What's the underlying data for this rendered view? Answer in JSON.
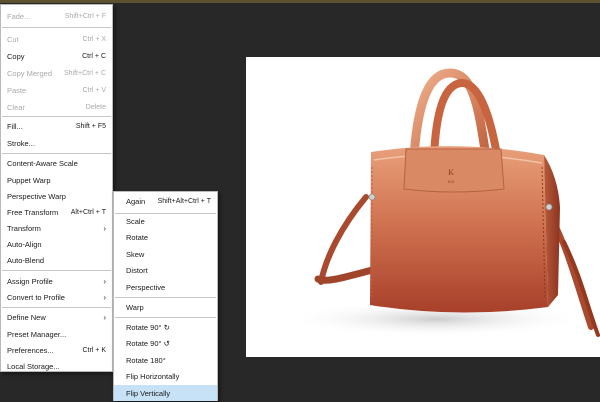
{
  "edit_menu": {
    "items": [
      {
        "label": "Fade...",
        "shortcut": "Shift+Ctrl + F",
        "disabled": true
      },
      {
        "label": "Cut",
        "shortcut": "Ctrl + X",
        "disabled": true
      },
      {
        "label": "Copy",
        "shortcut": "Ctrl + C",
        "disabled": false
      },
      {
        "label": "Copy Merged",
        "shortcut": "Shift+Ctrl + C",
        "disabled": true
      },
      {
        "label": "Paste",
        "shortcut": "Ctrl + V",
        "disabled": true
      },
      {
        "label": "Clear",
        "shortcut": "Delete",
        "disabled": true
      },
      {
        "label": "Fill...",
        "shortcut": "Shift + F5",
        "disabled": false
      },
      {
        "label": "Stroke...",
        "shortcut": "",
        "disabled": false
      },
      {
        "label": "Content-Aware Scale",
        "shortcut": "",
        "disabled": false
      },
      {
        "label": "Puppet Warp",
        "shortcut": "",
        "disabled": false
      },
      {
        "label": "Perspective Warp",
        "shortcut": "",
        "disabled": false
      },
      {
        "label": "Free Transform",
        "shortcut": "Alt+Ctrl + T",
        "disabled": false
      },
      {
        "label": "Transform",
        "shortcut": "",
        "disabled": false,
        "submenu": true
      },
      {
        "label": "Auto-Align",
        "shortcut": "",
        "disabled": false
      },
      {
        "label": "Auto-Blend",
        "shortcut": "",
        "disabled": false
      },
      {
        "label": "Assign Profile",
        "shortcut": "",
        "disabled": false,
        "submenu": true
      },
      {
        "label": "Convert to Profile",
        "shortcut": "",
        "disabled": false,
        "submenu": true
      },
      {
        "label": "Define New",
        "shortcut": "",
        "disabled": false,
        "submenu": true
      },
      {
        "label": "Preset Manager...",
        "shortcut": "",
        "disabled": false
      },
      {
        "label": "Preferences...",
        "shortcut": "Ctrl + K",
        "disabled": false
      },
      {
        "label": "Local Storage...",
        "shortcut": "",
        "disabled": false
      }
    ],
    "arrow_glyph": "›"
  },
  "transform_submenu": {
    "items": [
      {
        "label": "Again",
        "shortcut": "Shift+Alt+Ctrl + T"
      },
      {
        "label": "Scale",
        "shortcut": ""
      },
      {
        "label": "Rotate",
        "shortcut": ""
      },
      {
        "label": "Skew",
        "shortcut": ""
      },
      {
        "label": "Distort",
        "shortcut": ""
      },
      {
        "label": "Perspective",
        "shortcut": ""
      },
      {
        "label": "Warp",
        "shortcut": ""
      },
      {
        "label": "Rotate 90° ↻",
        "shortcut": ""
      },
      {
        "label": "Rotate 90° ↺",
        "shortcut": ""
      },
      {
        "label": "Rotate 180°",
        "shortcut": ""
      },
      {
        "label": "Flip Horizontally",
        "shortcut": ""
      },
      {
        "label": "Flip Vertically",
        "shortcut": "",
        "highlighted": true
      }
    ]
  },
  "document": {
    "image_subject": "orange-leather-handbag-photo"
  },
  "colors": {
    "workspace": "#282828",
    "menu_bg": "#ffffff",
    "highlight": "#c7e1f7",
    "bag_main": "#c8643f"
  }
}
